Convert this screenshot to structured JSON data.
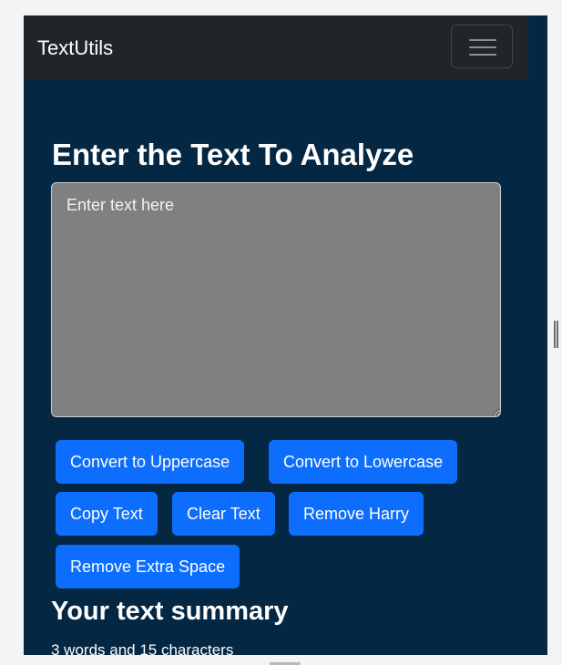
{
  "navbar": {
    "brand": "TextUtils",
    "toggler_icon": "hamburger-menu-icon"
  },
  "form": {
    "heading": "Enter the Text To Analyze",
    "placeholder": "Enter text here",
    "value": ""
  },
  "buttons": {
    "uppercase": "Convert to Uppercase",
    "lowercase": "Convert to Lowercase",
    "copy": "Copy Text",
    "clear": "Clear Text",
    "remove_harry": "Remove Harry",
    "remove_space": "Remove Extra Space"
  },
  "summary": {
    "title": "Your text summary",
    "stats": "3 words and 15 characters"
  },
  "colors": {
    "page_bg": "#042743",
    "navbar_bg": "#212529",
    "textarea_bg": "#808080",
    "button_bg": "#0d6efd"
  }
}
